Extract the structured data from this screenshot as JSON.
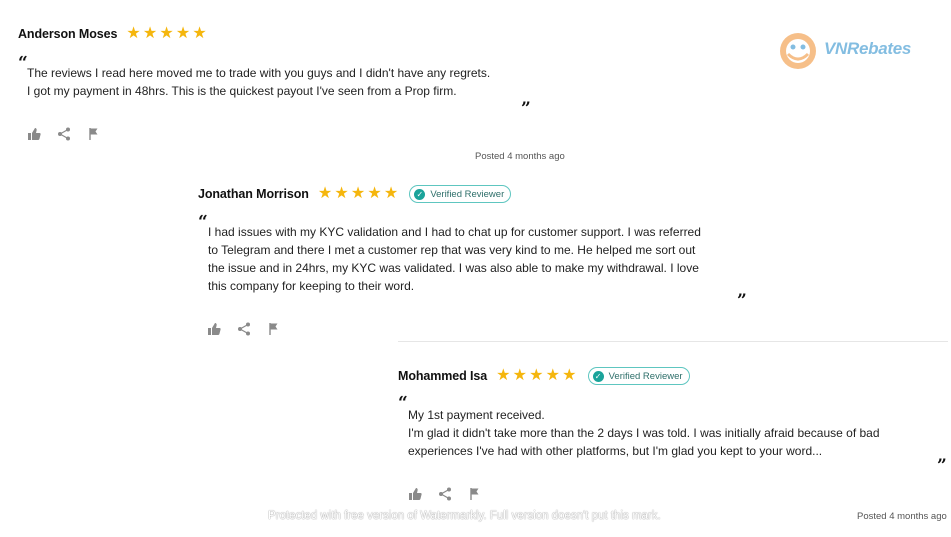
{
  "logo": {
    "name": "VNRebates",
    "brand_color": "#1e88c9",
    "accent_color": "#f08c2a"
  },
  "reviews": [
    {
      "author": "Anderson Moses",
      "rating": 5,
      "verified": false,
      "quote_open": "“",
      "quote_close": "”",
      "lines": [
        "The reviews I read here moved me to trade with you guys and I didn't have any regrets.",
        "I got my payment in 48hrs. This is the quickest payout I've seen from a Prop firm."
      ],
      "posted": "Posted 4 months ago"
    },
    {
      "author": "Jonathan Morrison",
      "rating": 5,
      "verified": true,
      "badge_label": "Verified Reviewer",
      "quote_open": "“",
      "quote_close": "”",
      "lines": [
        "I had issues with my KYC validation and I had to chat up for customer support. I was referred",
        "to Telegram and there I met a customer rep that was very kind to me. He helped me sort out",
        "the issue and in 24hrs, my KYC was validated. I was also able to make my withdrawal. I love",
        "this company for keeping to their word."
      ]
    },
    {
      "author": "Mohammed Isa",
      "rating": 5,
      "verified": true,
      "badge_label": "Verified Reviewer",
      "quote_open": "“",
      "quote_close": "”",
      "lines": [
        "My 1st payment received.",
        "I'm glad it didn't take more than the 2 days I was told. I was initially afraid because of bad",
        "experiences I've had with other platforms, but I'm glad you kept to your word..."
      ],
      "posted": "Posted 4 months ago"
    }
  ],
  "watermark": "Protected with free version of Watermarkly. Full version doesn't put this mark.",
  "colors": {
    "star": "#f5b60d",
    "badge_border": "#5ec6c0",
    "badge_check": "#1aa39a",
    "icon": "#8a8a8a"
  }
}
